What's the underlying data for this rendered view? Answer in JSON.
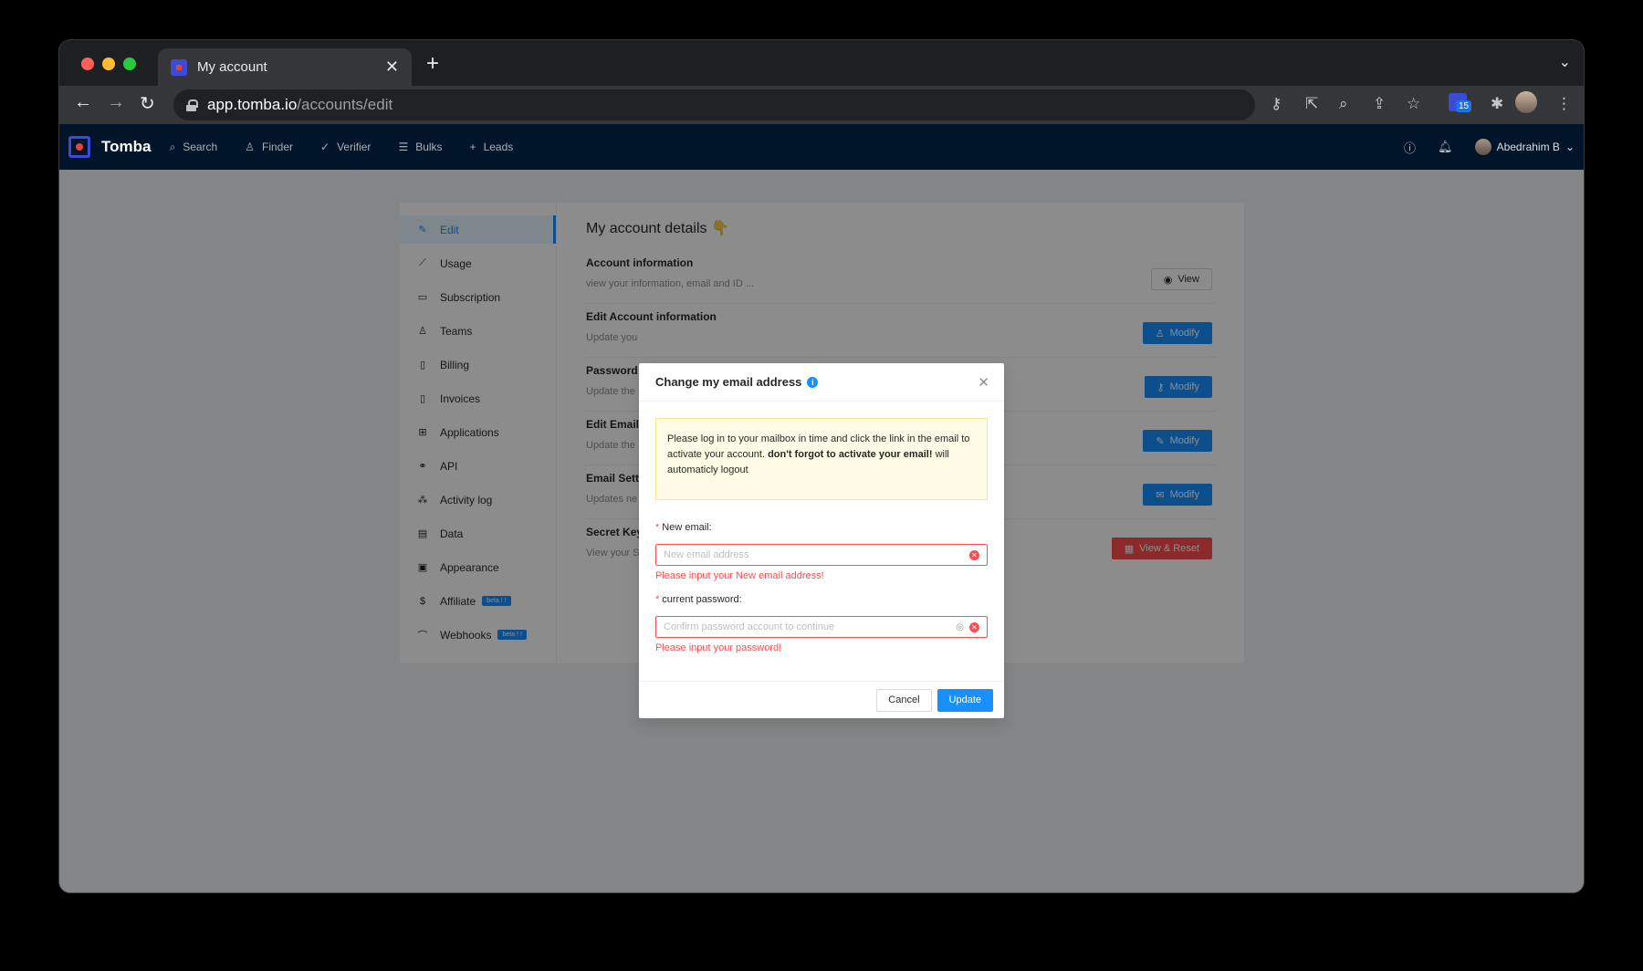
{
  "browser": {
    "tab_title": "My account",
    "url_host": "app.tomba.io",
    "url_path": "/accounts/edit",
    "extension_badge": "15"
  },
  "appbar": {
    "brand": "Tomba",
    "nav": [
      {
        "label": "Search",
        "icon": "search-icon"
      },
      {
        "label": "Finder",
        "icon": "user-icon"
      },
      {
        "label": "Verifier",
        "icon": "check-icon"
      },
      {
        "label": "Bulks",
        "icon": "list-icon"
      },
      {
        "label": "Leads",
        "icon": "plus-icon"
      }
    ],
    "user_name": "Abedrahim B"
  },
  "sidebar": {
    "items": [
      {
        "label": "Edit",
        "active": true
      },
      {
        "label": "Usage"
      },
      {
        "label": "Subscription"
      },
      {
        "label": "Teams"
      },
      {
        "label": "Billing"
      },
      {
        "label": "Invoices"
      },
      {
        "label": "Applications"
      },
      {
        "label": "API"
      },
      {
        "label": "Activity log"
      },
      {
        "label": "Data"
      },
      {
        "label": "Appearance"
      },
      {
        "label": "Affiliate",
        "badge": "beta ! !"
      },
      {
        "label": "Webhooks",
        "badge": "beta ! !"
      }
    ]
  },
  "main": {
    "title": "My account details",
    "title_emoji": "👇",
    "sections": [
      {
        "title": "Account information",
        "desc": "view your information, email and ID ...",
        "button": "View"
      },
      {
        "title": "Edit Account information",
        "desc": "Update you",
        "button": "Modify"
      },
      {
        "title": "Password",
        "desc": "Update the",
        "button": "Modify"
      },
      {
        "title": "Edit Email",
        "desc": "Update the",
        "button": "Modify"
      },
      {
        "title": "Email Settin",
        "desc": "Updates ne",
        "button": "Modify"
      },
      {
        "title": "Secret Key",
        "desc": "View your S",
        "button": "View & Reset"
      }
    ]
  },
  "modal": {
    "title": "Change my email address",
    "notice_pre": "Please log in to your mailbox in time and click the link in the email to activate your account. ",
    "notice_bold": "don't forgot to activate your email!",
    "notice_post": " will automaticly logout",
    "email_label": "New email",
    "email_placeholder": "New email address",
    "email_error": "Please input your New email address!",
    "password_label": "current password",
    "password_placeholder": "Confirm password account to continue",
    "password_error": "Please input your password!",
    "cancel": "Cancel",
    "update": "Update"
  },
  "colors": {
    "primary": "#1890ff",
    "danger": "#ff4d4f",
    "appbar": "#001529"
  }
}
